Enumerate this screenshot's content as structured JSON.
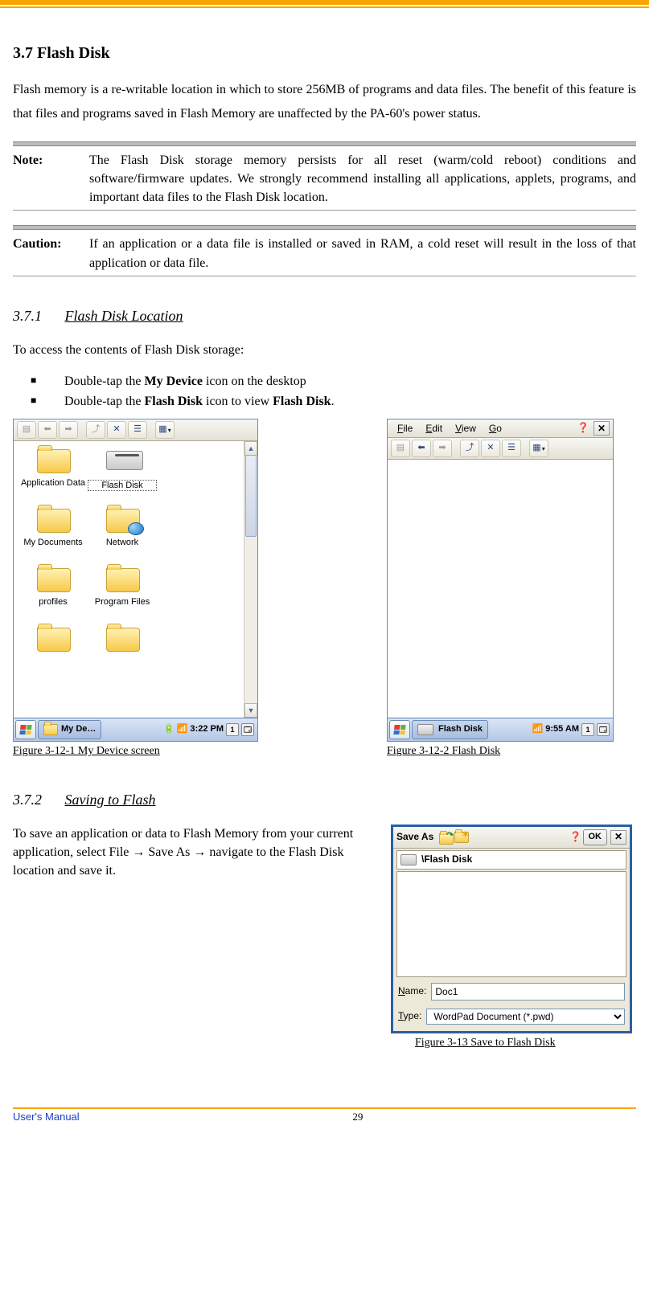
{
  "section": {
    "number": "3.7",
    "title": "Flash Disk"
  },
  "intro": "Flash memory is a re-writable location in which to store 256MB of programs and data files. The benefit of this feature is that files and programs saved in Flash Memory are unaffected by the PA-60's power status.",
  "note": {
    "label": "Note:",
    "body": "The Flash Disk storage memory persists for all reset (warm/cold reboot) conditions and software/firmware updates. We strongly recommend installing all applications, applets, programs, and important data files to the Flash Disk location."
  },
  "caution": {
    "label": "Caution:",
    "body": "If an application or a data file is installed or saved in RAM, a cold reset will result in the loss of that application or data file."
  },
  "sub1": {
    "number": "3.7.1",
    "title": "Flash Disk Location",
    "lead": "To access the contents of Flash Disk storage:",
    "b1a": "Double-tap the ",
    "b1b": "My Device",
    "b1c": " icon on the desktop",
    "b2a": "Double-tap the ",
    "b2b": "Flash Disk",
    "b2c": " icon to view ",
    "b2d": "Flash Disk",
    "b2e": "."
  },
  "fig1_caption": "Figure 3-12-1 My Device screen",
  "fig2_caption": "Figure 3-12-2 Flash Disk",
  "scr1": {
    "icons": {
      "appdata": "Application Data",
      "flashdisk": "Flash Disk",
      "mydocs": "My Documents",
      "network": "Network",
      "profiles": "profiles",
      "programfiles": "Program Files"
    },
    "taskbar": {
      "app": "My De…",
      "clock": "3:22 PM",
      "tray_num": "1"
    }
  },
  "scr2": {
    "menu": {
      "file": "File",
      "edit": "Edit",
      "view": "View",
      "go": "Go"
    },
    "taskbar": {
      "app": "Flash Disk",
      "clock": "9:55 AM",
      "tray_num": "1"
    }
  },
  "sub2": {
    "number": "3.7.2",
    "title": "Saving to Flash",
    "body": "To save an application or data to Flash Memory from your current application, select File → Save As → navigate to the Flash Disk location and save it."
  },
  "scr3": {
    "title": "Save As",
    "ok": "OK",
    "path": "\\Flash Disk",
    "name_label": "Name:",
    "name_value": "Doc1",
    "type_label": "Type:",
    "type_value": "WordPad Document (*.pwd)"
  },
  "fig3_caption": "Figure 3-13  Save to Flash Disk",
  "footer": {
    "left": "User's Manual",
    "page": "29"
  }
}
